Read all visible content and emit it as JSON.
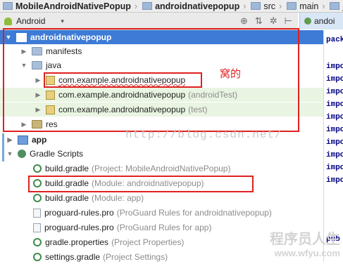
{
  "breadcrumbs": {
    "project": "MobileAndroidNativePopup",
    "module": "androidnativepopup",
    "src": "src",
    "main": "main",
    "next": "j"
  },
  "toolbar": {
    "view_selector": "Android",
    "caret": "▾",
    "icons": [
      "⊕",
      "⇅",
      "✲",
      "⊢"
    ]
  },
  "editor_tab": {
    "label": "andoi"
  },
  "editor_lines": [
    "pack",
    "impo",
    "impo",
    "impo",
    "impo",
    "impo",
    "impo",
    "impo",
    "impo",
    "impo",
    "impo",
    "pub"
  ],
  "tree": {
    "root": {
      "label": "androidnativepopup"
    },
    "manifests": "manifests",
    "java": "java",
    "pkg1": "com.example.androidnativepopup",
    "pkg2": "com.example.androidnativepopup",
    "pkg2_hint": "(androidTest)",
    "pkg3": "com.example.androidnativepopup",
    "pkg3_hint": "(test)",
    "res": "res",
    "app": "app",
    "gradle_scripts": "Gradle Scripts",
    "bg1": "build.gradle",
    "bg1_hint": "(Project: MobileAndroidNativePopup)",
    "bg2": "build.gradle",
    "bg2_hint": "(Module: androidnativepopup)",
    "bg3": "build.gradle",
    "bg3_hint": "(Module: app)",
    "pr1": "proguard-rules.pro",
    "pr1_hint": "(ProGuard Rules for androidnativepopup)",
    "pr2": "proguard-rules.pro",
    "pr2_hint": "(ProGuard Rules for app)",
    "gp": "gradle.properties",
    "gp_hint": "(Project Properties)",
    "sg": "settings.gradle",
    "sg_hint": "(Project Settings)"
  },
  "annotation": "窝的",
  "watermark": "http://blog.csdn.net/",
  "watermark2": {
    "title": "程序员人生",
    "url": "www.wfyu.com"
  },
  "colors": {
    "selection": "#3d7bd6",
    "highlight_box": "#e02020",
    "test_rows": "#e9f5e2"
  }
}
